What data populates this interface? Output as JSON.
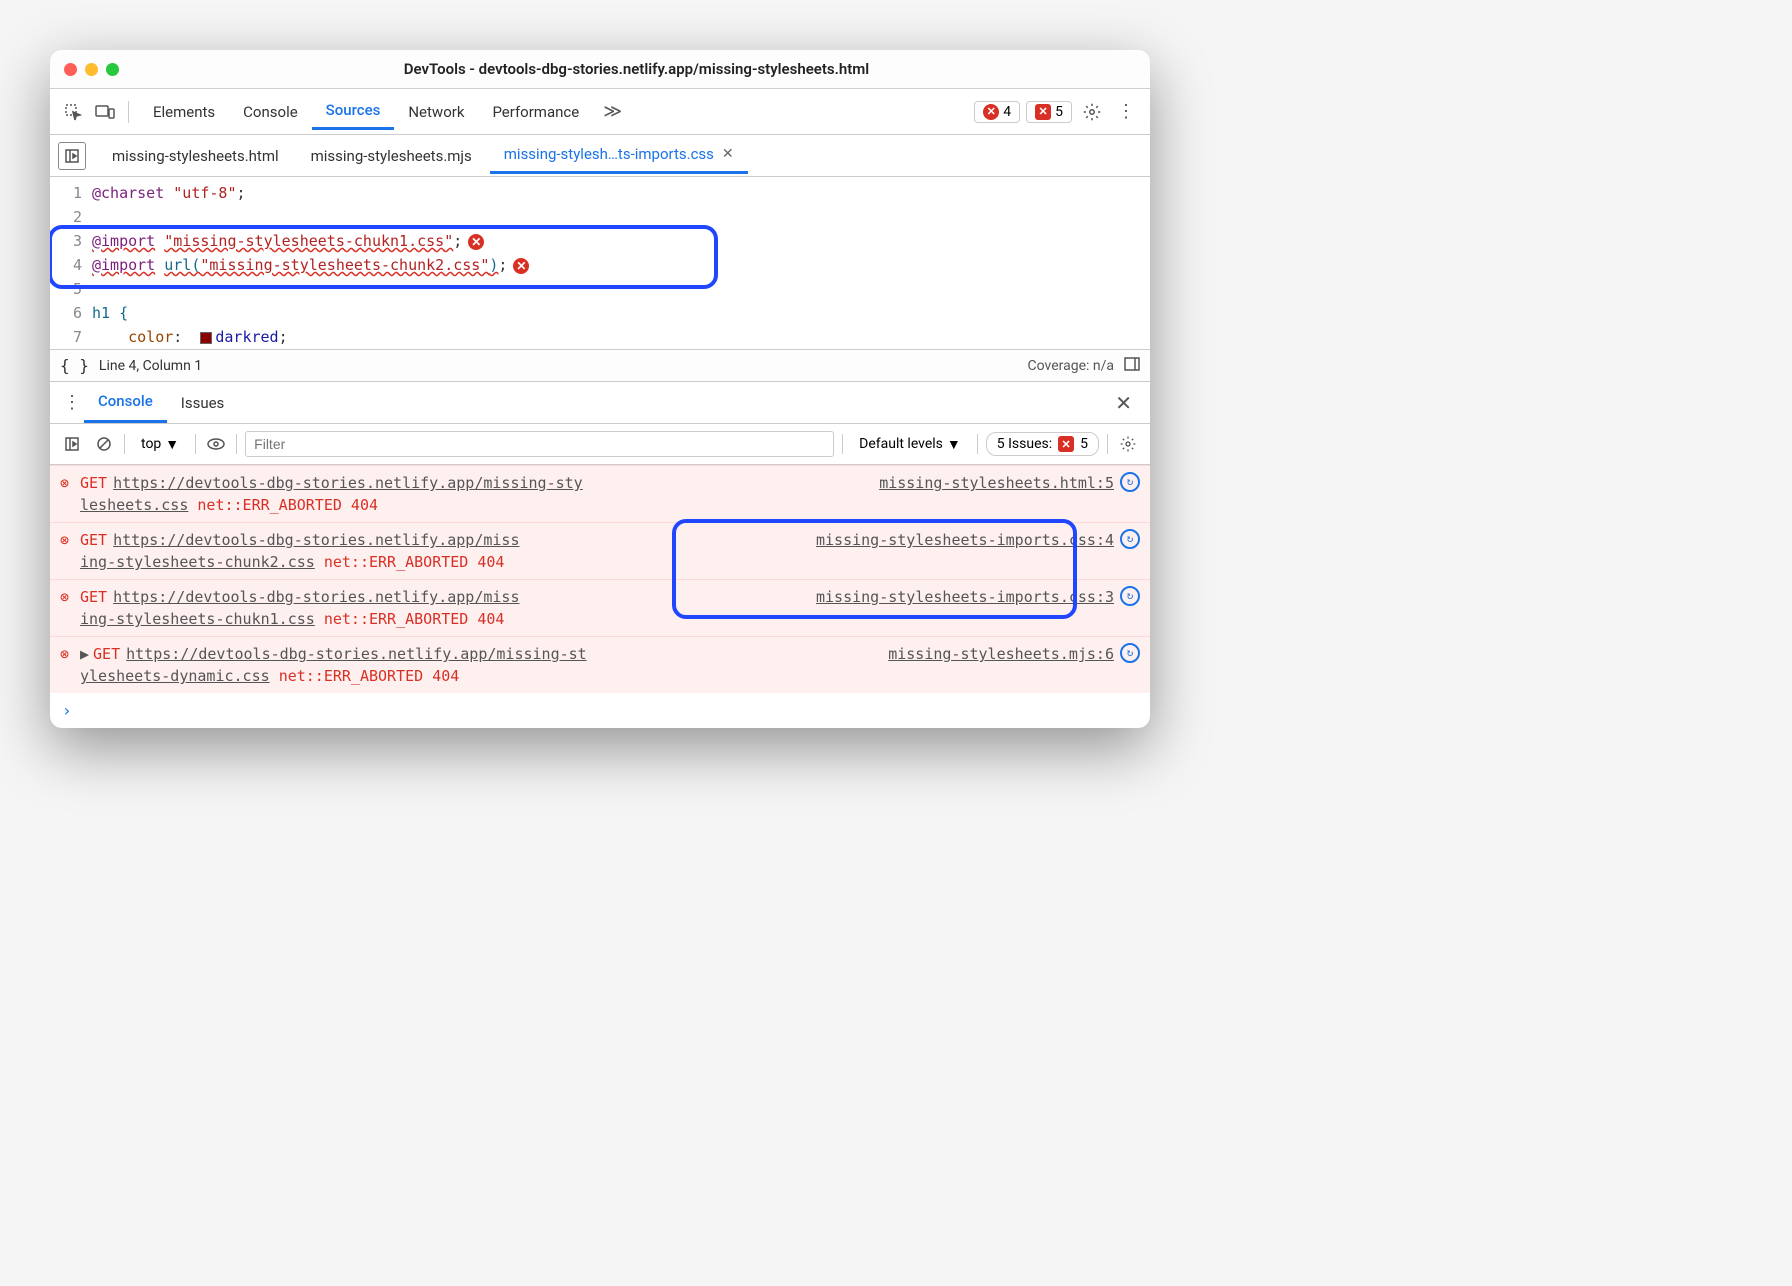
{
  "window": {
    "title": "DevTools - devtools-dbg-stories.netlify.app/missing-stylesheets.html"
  },
  "toolbar": {
    "tabs": [
      "Elements",
      "Console",
      "Sources",
      "Network",
      "Performance"
    ],
    "active_tab": "Sources",
    "error_badge_count": "4",
    "issue_badge_count": "5"
  },
  "file_tabs": {
    "items": [
      {
        "label": "missing-stylesheets.html",
        "active": false,
        "closable": false
      },
      {
        "label": "missing-stylesheets.mjs",
        "active": false,
        "closable": false
      },
      {
        "label": "missing-stylesh…ts-imports.css",
        "active": true,
        "closable": true
      }
    ]
  },
  "editor": {
    "lines": [
      {
        "n": "1"
      },
      {
        "n": "2"
      },
      {
        "n": "3"
      },
      {
        "n": "4"
      },
      {
        "n": "5"
      },
      {
        "n": "6"
      },
      {
        "n": "7"
      }
    ],
    "l1_at": "@charset",
    "l1_str": "\"utf-8\"",
    "l3_at": "@import",
    "l3_str": "\"missing-stylesheets-chukn1.css\"",
    "l4_at": "@import",
    "l4_fn": "url(",
    "l4_str": "\"missing-stylesheets-chunk2.css\"",
    "l4_close": ")",
    "l6_sel": "h1 {",
    "l7_prop": "color",
    "l7_val": "darkred"
  },
  "status": {
    "pos": "Line 4, Column 1",
    "coverage": "Coverage: n/a"
  },
  "drawer": {
    "tabs": [
      "Console",
      "Issues"
    ],
    "active": "Console"
  },
  "console_toolbar": {
    "context": "top",
    "filter_placeholder": "Filter",
    "levels": "Default levels",
    "issues_label": "5 Issues:",
    "issues_count": "5"
  },
  "console": {
    "rows": [
      {
        "method": "GET",
        "url_a": "https://devtools-dbg-stories.netlify.app/missing-sty",
        "url_b": "lesheets.css",
        "err": "net::ERR_ABORTED 404",
        "src": "missing-stylesheets.html:5",
        "expand": false
      },
      {
        "method": "GET",
        "url_a": "https://devtools-dbg-stories.netlify.app/miss",
        "url_b": "ing-stylesheets-chunk2.css",
        "err": "net::ERR_ABORTED 404",
        "src": "missing-stylesheets-imports.css:4",
        "expand": false
      },
      {
        "method": "GET",
        "url_a": "https://devtools-dbg-stories.netlify.app/miss",
        "url_b": "ing-stylesheets-chukn1.css",
        "err": "net::ERR_ABORTED 404",
        "src": "missing-stylesheets-imports.css:3",
        "expand": false
      },
      {
        "method": "GET",
        "url_a": "https://devtools-dbg-stories.netlify.app/missing-st",
        "url_b": "ylesheets-dynamic.css",
        "err": "net::ERR_ABORTED 404",
        "src": "missing-stylesheets.mjs:6",
        "expand": true
      }
    ]
  }
}
